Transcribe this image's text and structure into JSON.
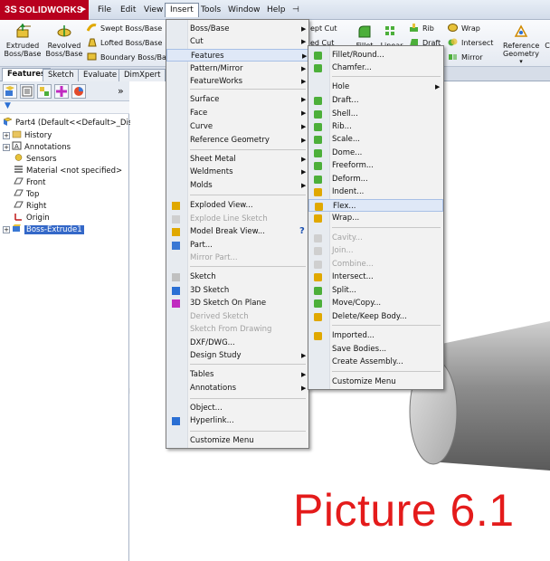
{
  "app": {
    "brand": "SOLIDWORKS",
    "ds_mark": "3S",
    "brand_arrow": "▶"
  },
  "menubar": {
    "items": [
      "File",
      "Edit",
      "View",
      "Insert",
      "Tools",
      "Window",
      "Help"
    ],
    "pin": "⊣"
  },
  "command_manager": {
    "extruded": "Extruded\nBoss/Base",
    "revolved": "Revolved\nBoss/Base",
    "swept": "Swept Boss/Base",
    "lofted": "Lofted Boss/Base",
    "boundary": "Boundary Boss/Base",
    "swept_cut": "ept Cut",
    "cut2": "ed Cut",
    "fillet": "Fillet",
    "linear": "Linear",
    "rib": "Rib",
    "draft": "Draft",
    "wrap": "Wrap",
    "intersect": "Intersect",
    "mirror": "Mirror",
    "refgeo": "Reference\nGeometry",
    "refgeo_arrow": "▾",
    "cut_c": "C"
  },
  "tabs": [
    "Features",
    "Sketch",
    "Evaluate",
    "DimXpert"
  ],
  "panel": {
    "more": "»",
    "filter_icon": "▼",
    "tree": [
      {
        "label": "Part4  (Default<<Default>_Dis",
        "indent": 0,
        "exp": ""
      },
      {
        "label": "History",
        "exp": "+"
      },
      {
        "label": "Annotations",
        "exp": "+"
      },
      {
        "label": "Sensors",
        "exp": ""
      },
      {
        "label": "Material <not specified>",
        "exp": ""
      },
      {
        "label": "Front",
        "exp": ""
      },
      {
        "label": "Top",
        "exp": ""
      },
      {
        "label": "Right",
        "exp": ""
      },
      {
        "label": "Origin",
        "exp": ""
      },
      {
        "label": "Boss-Extrude1",
        "exp": "+"
      }
    ]
  },
  "insert_menu": {
    "items": [
      {
        "label": "Boss/Base",
        "sub": true
      },
      {
        "label": "Cut",
        "sub": true
      },
      {
        "label": "Features",
        "sub": true,
        "hl": true
      },
      {
        "label": "Pattern/Mirror",
        "sub": true
      },
      {
        "label": "FeatureWorks",
        "sub": true
      },
      {
        "label": "Surface",
        "sub": true
      },
      {
        "label": "Face",
        "sub": true
      },
      {
        "label": "Curve",
        "sub": true
      },
      {
        "label": "Reference Geometry",
        "sub": true
      },
      {
        "label": "Sheet Metal",
        "sub": true
      },
      {
        "label": "Weldments",
        "sub": true
      },
      {
        "label": "Molds",
        "sub": true
      },
      {
        "label": "Exploded View...",
        "icon": true
      },
      {
        "label": "Explode Line Sketch",
        "dis": true,
        "icon": true
      },
      {
        "label": "Model Break View...",
        "icon": true
      },
      {
        "label": "Part...",
        "icon": true
      },
      {
        "label": "Mirror Part...",
        "dis": true
      },
      {
        "label": "Sketch",
        "icon": true
      },
      {
        "label": "3D Sketch",
        "icon": true
      },
      {
        "label": "3D Sketch On Plane",
        "icon": true
      },
      {
        "label": "Derived Sketch",
        "dis": true
      },
      {
        "label": "Sketch From Drawing",
        "dis": true
      },
      {
        "label": "DXF/DWG..."
      },
      {
        "label": "Design Study",
        "sub": true
      },
      {
        "label": "Tables",
        "sub": true
      },
      {
        "label": "Annotations",
        "sub": true
      },
      {
        "label": "Object..."
      },
      {
        "label": "Hyperlink...",
        "icon": true
      },
      {
        "label": "Customize Menu"
      }
    ],
    "help_mark": "?"
  },
  "features_menu": {
    "items": [
      {
        "label": "Fillet/Round..."
      },
      {
        "label": "Chamfer..."
      },
      {
        "label": "Hole",
        "sub": true
      },
      {
        "label": "Draft..."
      },
      {
        "label": "Shell..."
      },
      {
        "label": "Rib..."
      },
      {
        "label": "Scale..."
      },
      {
        "label": "Dome..."
      },
      {
        "label": "Freeform..."
      },
      {
        "label": "Deform..."
      },
      {
        "label": "Indent..."
      },
      {
        "label": "Flex...",
        "hl": true
      },
      {
        "label": "Wrap..."
      },
      {
        "label": "Cavity...",
        "dis": true
      },
      {
        "label": "Join...",
        "dis": true
      },
      {
        "label": "Combine...",
        "dis": true
      },
      {
        "label": "Intersect..."
      },
      {
        "label": "Split..."
      },
      {
        "label": "Move/Copy..."
      },
      {
        "label": "Delete/Keep Body..."
      },
      {
        "label": "Imported..."
      },
      {
        "label": "Save Bodies..."
      },
      {
        "label": "Create Assembly..."
      },
      {
        "label": "Customize Menu"
      }
    ]
  },
  "caption": "Picture 6.1",
  "colors": {
    "brand": "#b8001e",
    "caption": "#e41b1b",
    "highlight": "#dfe8f7"
  }
}
